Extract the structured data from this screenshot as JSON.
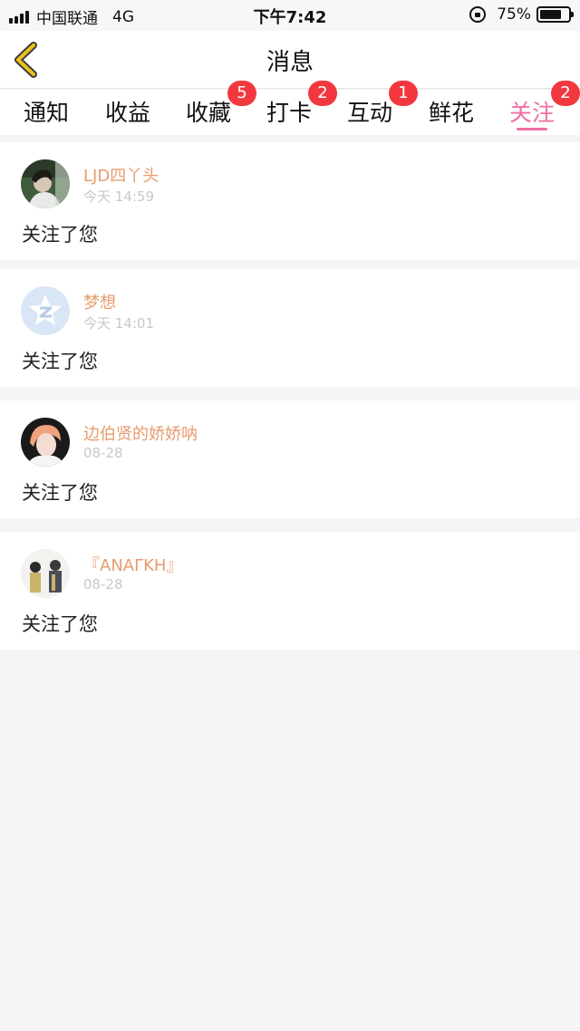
{
  "status_bar": {
    "carrier": "中国联通",
    "network": "4G",
    "time": "下午7:42",
    "battery_percent": "75%",
    "battery_level": 0.75
  },
  "header": {
    "title": "消息",
    "back_icon": "chevron-left-icon",
    "back_color": "#e8c21c"
  },
  "tabs": [
    {
      "label": "通知",
      "badge": ""
    },
    {
      "label": "收益",
      "badge": ""
    },
    {
      "label": "收藏",
      "badge": "5"
    },
    {
      "label": "打卡",
      "badge": "2"
    },
    {
      "label": "互动",
      "badge": "1"
    },
    {
      "label": "鲜花",
      "badge": ""
    },
    {
      "label": "关注",
      "badge": "2",
      "active": true
    }
  ],
  "colors": {
    "accent": "#ee6fa4",
    "badge": "#f2383f",
    "username": "#e89b6c",
    "timestamp": "#c8c8c8"
  },
  "notifications": [
    {
      "name": "LJD四丫头",
      "time": "今天 14:59",
      "text": "关注了您",
      "avatar": "photo-avatar"
    },
    {
      "name": "梦想",
      "time": "今天 14:01",
      "text": "关注了您",
      "avatar": "qzone-star-avatar"
    },
    {
      "name": "边伯贤的娇娇呐",
      "time": "08-28",
      "text": "关注了您",
      "avatar": "photo-avatar"
    },
    {
      "name": "『ΑΝΑΓΚΗ』",
      "time": "08-28",
      "text": "关注了您",
      "avatar": "photo-avatar"
    }
  ]
}
